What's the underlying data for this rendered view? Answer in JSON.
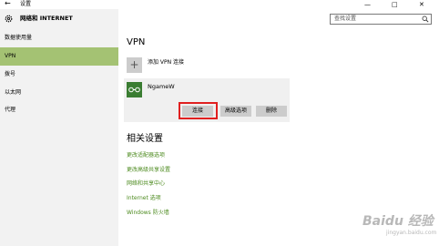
{
  "window": {
    "title": "设置",
    "back_glyph": "←",
    "controls": {
      "minimize": "—",
      "maximize": "□",
      "close": "✕"
    }
  },
  "header": {
    "app_title": "网络和 INTERNET",
    "search_placeholder": "查找设置"
  },
  "sidebar": {
    "items": [
      {
        "label": "数据使用量",
        "active": false
      },
      {
        "label": "VPN",
        "active": true
      },
      {
        "label": "拨号",
        "active": false
      },
      {
        "label": "以太网",
        "active": false
      },
      {
        "label": "代理",
        "active": false
      }
    ]
  },
  "main": {
    "title": "VPN",
    "add_vpn": {
      "label": "添加 VPN 连接"
    },
    "vpn_connection": {
      "name": "NgameW",
      "buttons": {
        "connect": "连接",
        "advanced": "高级选项",
        "delete": "删除"
      }
    },
    "related_title": "相关设置",
    "related_links": [
      "更改适配器选项",
      "更改高级共享设置",
      "网络和共享中心",
      "Internet 选项",
      "Windows 防火墙"
    ]
  },
  "watermark": {
    "brand": "Baidu 经验",
    "sub": "jingyan.baidu.com"
  },
  "colors": {
    "accent": "#a4c273",
    "link": "#4c8a1e",
    "highlight": "#e02020",
    "vpn_icon_bg": "#3a7d32"
  }
}
